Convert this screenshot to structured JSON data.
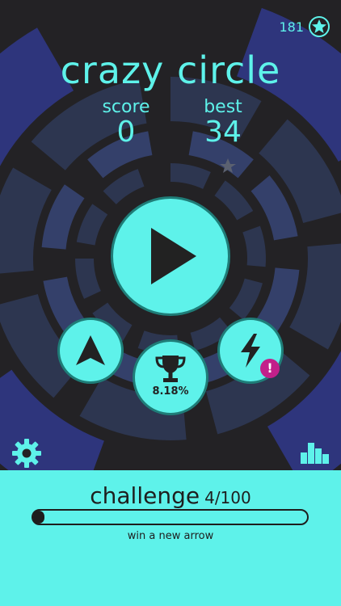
{
  "colors": {
    "accent": "#5ef2ea",
    "background": "#232225",
    "ring_dark": "#2d3650",
    "ring_mid": "#34406a",
    "ring_blue": "#2e357c",
    "badge": "#c2208a"
  },
  "header": {
    "title": "crazy circle"
  },
  "currency": {
    "stars": "181",
    "icon": "star-icon"
  },
  "stats": {
    "score_label": "score",
    "score_value": "0",
    "best_label": "best",
    "best_value": "34"
  },
  "buttons": {
    "play": {
      "icon": "play-icon"
    },
    "arrow": {
      "icon": "arrow-icon"
    },
    "trophy": {
      "icon": "trophy-icon",
      "percent": "8.18%"
    },
    "boost": {
      "icon": "lightning-icon",
      "badge": "!"
    },
    "settings": {
      "icon": "gear-icon"
    },
    "leaderboard": {
      "icon": "bar-chart-icon"
    }
  },
  "challenge": {
    "label": "challenge",
    "count": "4/100",
    "progress": 0.04,
    "goal": "win a new arrow"
  }
}
